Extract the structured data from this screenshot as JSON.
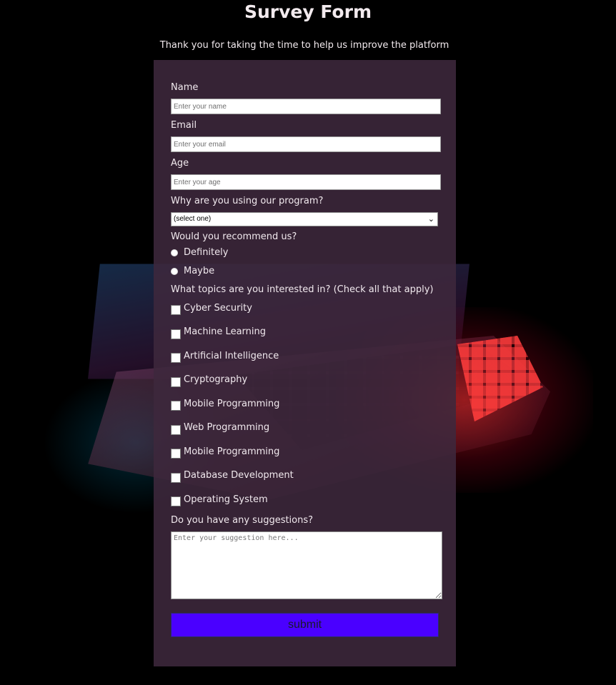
{
  "page": {
    "title": "Survey Form",
    "subtitle": "Thank you for taking the time to help us improve the platform"
  },
  "form": {
    "name_label": "Name",
    "name_placeholder": "Enter your name",
    "email_label": "Email",
    "email_placeholder": "Enter your email",
    "age_label": "Age",
    "age_placeholder": "Enter your age",
    "reason_label": "Why are you using our program?",
    "reason_selected": "(select one)",
    "recommend_label": "Would you recommend us?",
    "recommend_options": [
      "Definitely",
      "Maybe"
    ],
    "topics_label": "What topics are you interested in? (Check all that apply)",
    "topics": [
      "Cyber Security",
      "Machine Learning",
      "Artificial Intelligence",
      "Cryptography",
      "Mobile Programming",
      "Web Programming",
      "Mobile Programming",
      "Database Development",
      "Operating System"
    ],
    "suggestions_label": "Do you have any suggestions?",
    "suggestions_placeholder": "Enter your suggestion here...",
    "submit_label": "submit"
  },
  "colors": {
    "submit_bg": "#4a00ff",
    "card_bg": "#3e283c"
  }
}
